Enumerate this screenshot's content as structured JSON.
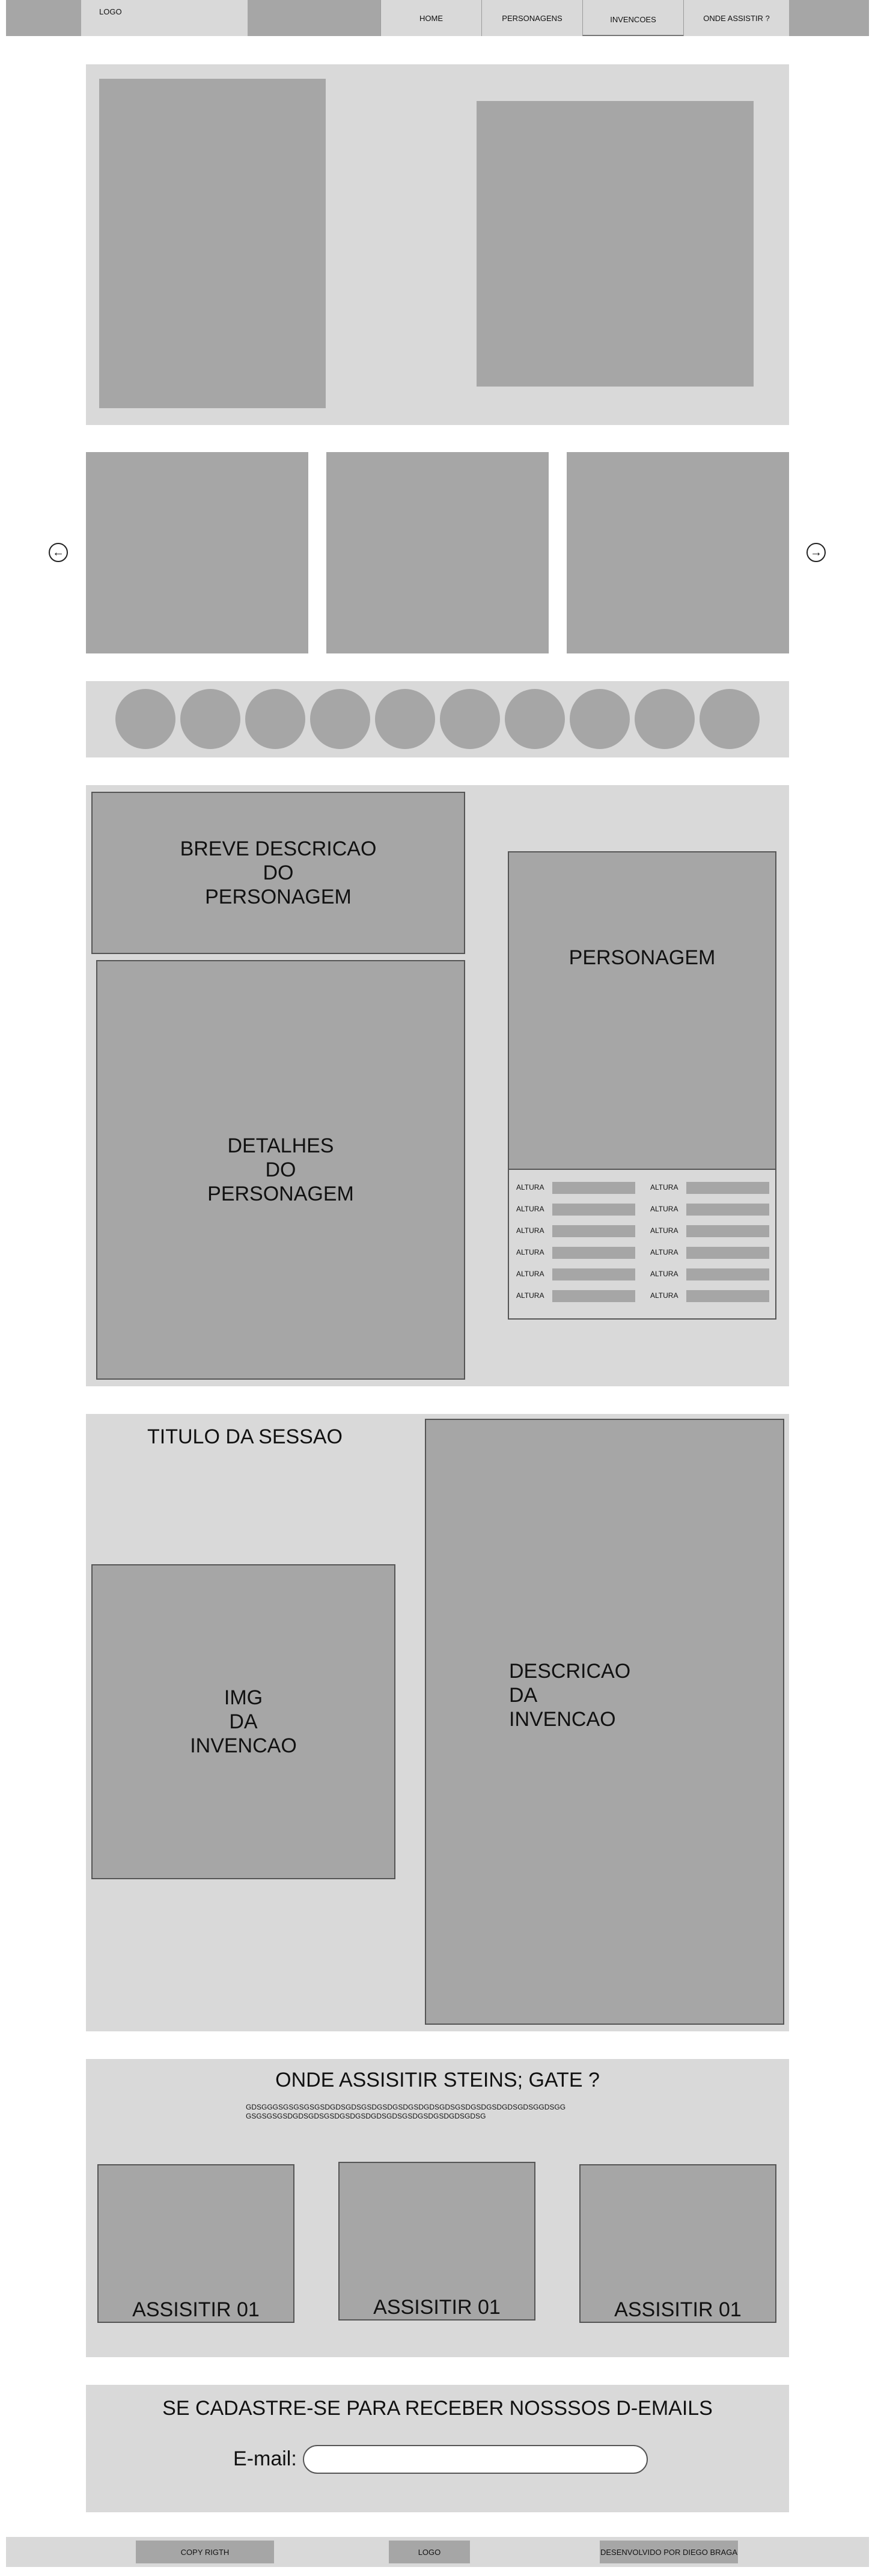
{
  "header": {
    "logo": "LOGO",
    "nav": [
      {
        "label": "HOME"
      },
      {
        "label": "PERSONAGENS"
      },
      {
        "label": "INVENCOES"
      },
      {
        "label": "ONDE ASSISTIR ?"
      }
    ]
  },
  "carousel": {
    "prev_icon": "arrow-left-circle-icon",
    "next_icon": "arrow-right-circle-icon"
  },
  "character": {
    "brief": "BREVE DESCRICAO\nDO\nPERSONAGEM",
    "details": "DETALHES\nDO\nPERSONAGEM",
    "name": "PERSONAGEM",
    "stats": [
      {
        "label": "ALTURA"
      },
      {
        "label": "ALTURA"
      },
      {
        "label": "ALTURA"
      },
      {
        "label": "ALTURA"
      },
      {
        "label": "ALTURA"
      },
      {
        "label": "ALTURA"
      },
      {
        "label": "ALTURA"
      },
      {
        "label": "ALTURA"
      },
      {
        "label": "ALTURA"
      },
      {
        "label": "ALTURA"
      },
      {
        "label": "ALTURA"
      },
      {
        "label": "ALTURA"
      }
    ]
  },
  "invention": {
    "section_title": "TITULO DA SESSAO",
    "image": "IMG\nDA\nINVENCAO",
    "description": "DESCRICAO\nDA\nINVENCAO"
  },
  "watch": {
    "title": "ONDE ASSISITIR STEINS; GATE ?",
    "text": "GDSGGGSGSGSGSGSDGDSGDSGSDGSDGSDGSDGDSGDSGSDGSDGSDGDSGDSGGDSGG\nGSGSGSGSDGDSGDSGSDGSDGSDGDSGDSGSDGSDGSDGDSGDSG",
    "buttons": [
      {
        "label": "ASSISITIR 01"
      },
      {
        "label": "ASSISITIR 01"
      },
      {
        "label": "ASSISITIR 01"
      }
    ]
  },
  "newsletter": {
    "title": "SE CADASTRE-SE PARA RECEBER NOSSSOS D-EMAILS",
    "email_label": "E-mail:",
    "email_value": ""
  },
  "footer": {
    "copyright": "COPY RIGTH",
    "logo": "LOGO",
    "credit": "DESENVOLVIDO POR DIEGO BRAGA"
  }
}
